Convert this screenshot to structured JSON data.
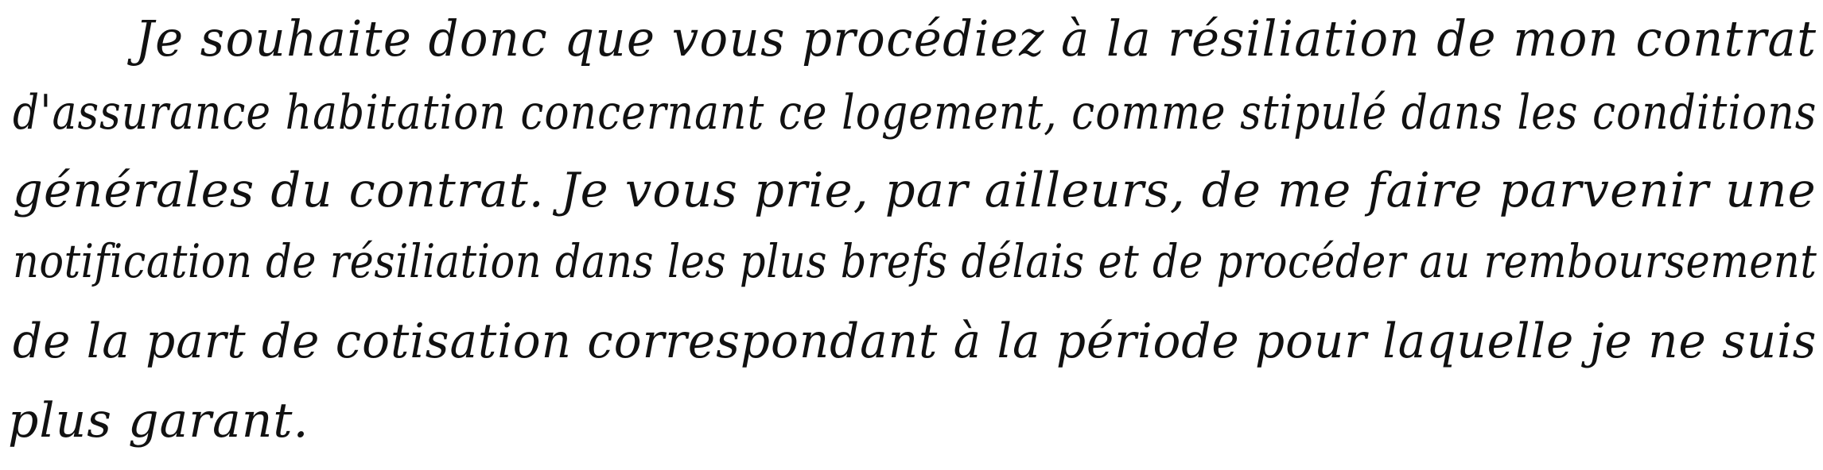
{
  "document": {
    "lines": [
      "Je souhaite donc que vous procédiez à la résiliation de mon contrat",
      "d'assurance habitation concernant ce logement, comme stipulé dans les conditions",
      "générales du contrat. Je vous prie, par ailleurs, de me faire parvenir une",
      "notification de résiliation dans les plus brefs délais et de procéder au remboursement",
      "de la part de cotisation correspondant à la période pour laquelle je ne suis",
      "plus garant."
    ]
  }
}
